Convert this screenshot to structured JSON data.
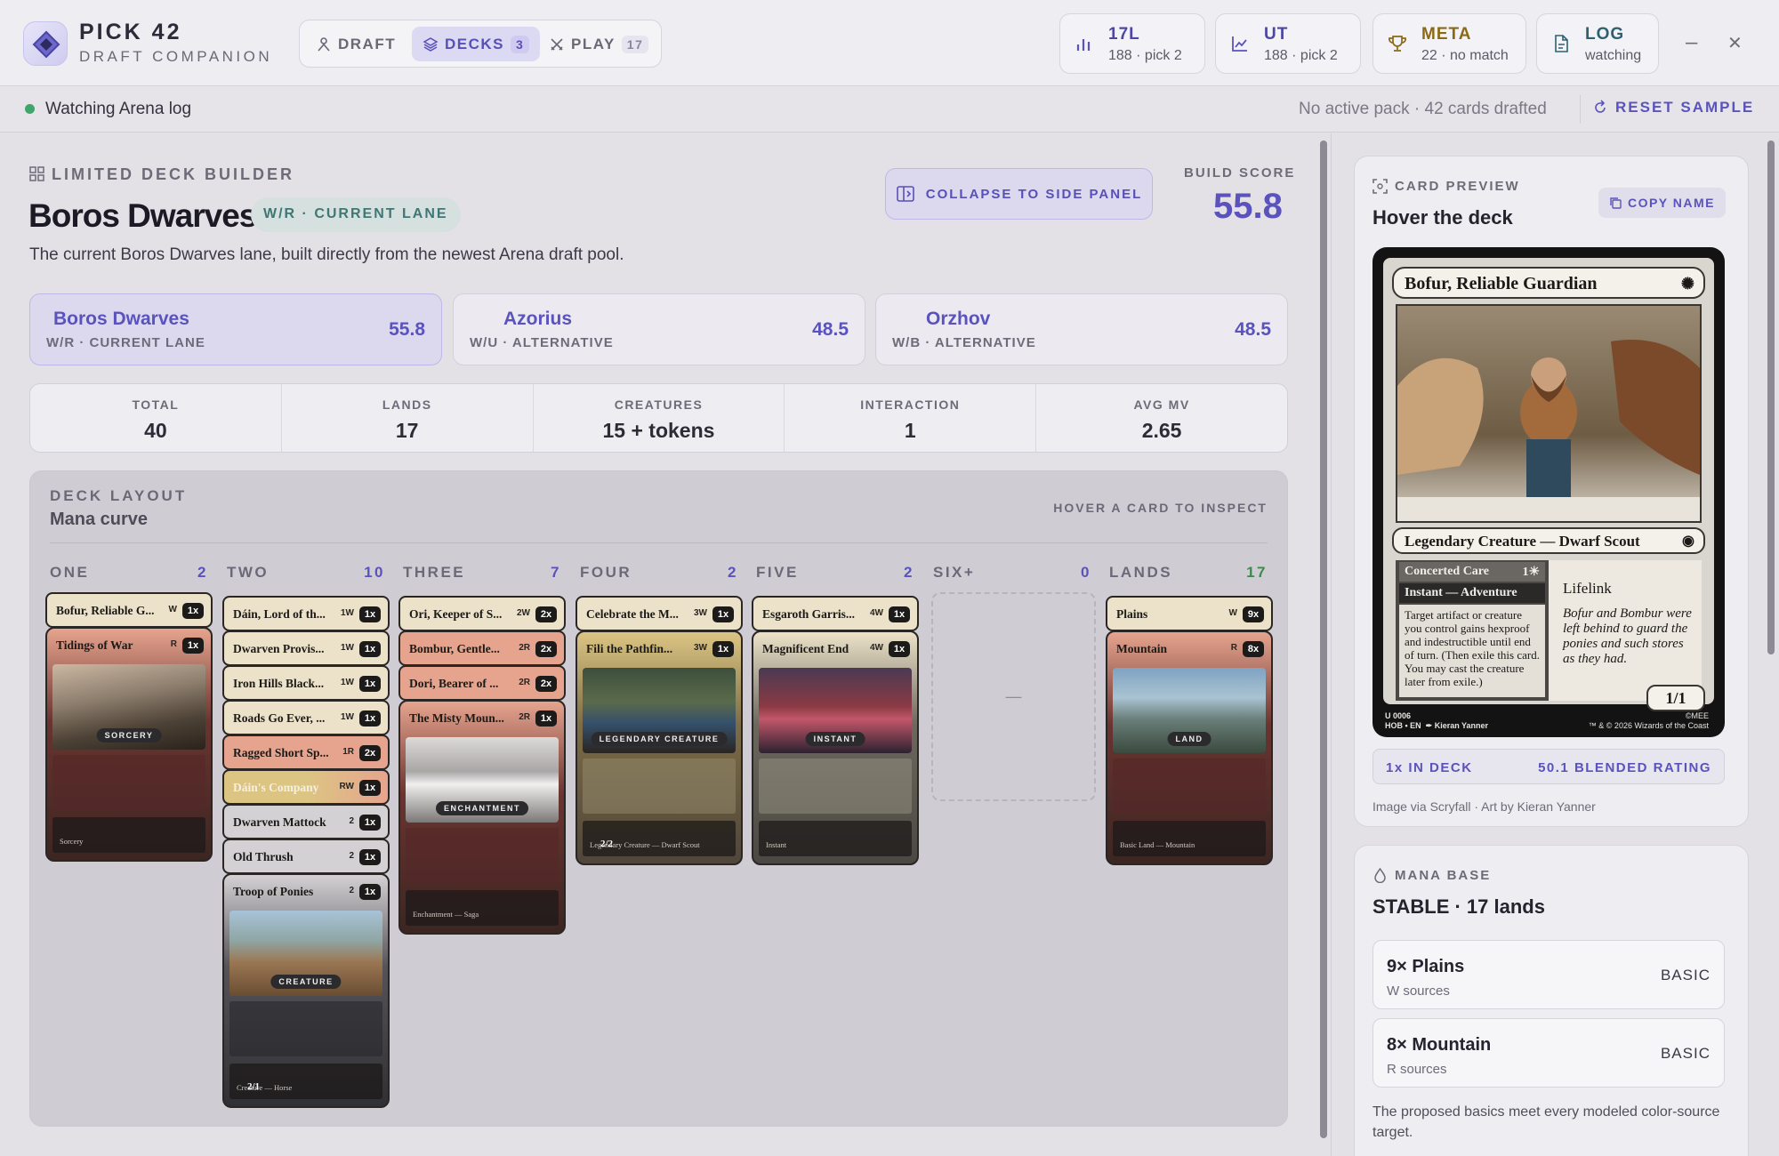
{
  "app": {
    "name": "PICK 42",
    "subtitle": "DRAFT COMPANION"
  },
  "nav": [
    {
      "label": "DRAFT",
      "count": ""
    },
    {
      "label": "DECKS",
      "count": "3"
    },
    {
      "label": "PLAY",
      "count": "17"
    }
  ],
  "top_stats": [
    {
      "title": "17L",
      "sub": "188 · pick 2"
    },
    {
      "title": "UT",
      "sub": "188 · pick 2"
    },
    {
      "title": "META",
      "sub": "22 · no match"
    },
    {
      "title": "LOG",
      "sub": "watching"
    }
  ],
  "window": {
    "minimize": "–",
    "close": "✕"
  },
  "status": {
    "text": "Watching Arena log",
    "right": "No active pack · 42 cards drafted",
    "reset": "RESET SAMPLE"
  },
  "builder": {
    "section": "LIMITED DECK BUILDER",
    "title": "Boros Dwarves",
    "lane_pill": "W/R · CURRENT LANE",
    "description": "The current Boros Dwarves lane, built directly from the newest Arena draft pool.",
    "collapse": "COLLAPSE TO SIDE PANEL",
    "build_label": "BUILD SCORE",
    "build_score": "55.8"
  },
  "lanes": [
    {
      "name": "Boros Dwarves",
      "type": "W/R · CURRENT LANE",
      "score": "55.8"
    },
    {
      "name": "Azorius",
      "type": "W/U · ALTERNATIVE",
      "score": "48.5"
    },
    {
      "name": "Orzhov",
      "type": "W/B · ALTERNATIVE",
      "score": "48.5"
    }
  ],
  "stats": [
    {
      "label": "TOTAL",
      "value": "40"
    },
    {
      "label": "LANDS",
      "value": "17"
    },
    {
      "label": "CREATURES",
      "value": "15 + tokens"
    },
    {
      "label": "INTERACTION",
      "value": "1"
    },
    {
      "label": "AVG MV",
      "value": "2.65"
    }
  ],
  "layout": {
    "label": "DECK LAYOUT",
    "title": "Mana curve",
    "hint": "HOVER A CARD TO INSPECT",
    "empty_marker": "—",
    "columns": [
      {
        "name": "ONE",
        "count": "2"
      },
      {
        "name": "TWO",
        "count": "10"
      },
      {
        "name": "THREE",
        "count": "7"
      },
      {
        "name": "FOUR",
        "count": "2"
      },
      {
        "name": "FIVE",
        "count": "2"
      },
      {
        "name": "SIX+",
        "count": "0"
      },
      {
        "name": "LANDS",
        "count": "17"
      }
    ]
  },
  "cards": {
    "one": [
      {
        "name": "Bofur, Reliable G...",
        "cost": "W",
        "qty": "1x"
      },
      {
        "name": "Tidings of War",
        "cost": "R",
        "qty": "1x",
        "type": "SORCERY",
        "bottom": "Sorcery",
        "pt": ""
      }
    ],
    "two": [
      {
        "name": "Dáin, Lord of th...",
        "cost": "1W",
        "qty": "1x"
      },
      {
        "name": "Dwarven Provis...",
        "cost": "1W",
        "qty": "1x"
      },
      {
        "name": "Iron Hills Black...",
        "cost": "1W",
        "qty": "1x"
      },
      {
        "name": "Roads Go Ever, ...",
        "cost": "1W",
        "qty": "1x"
      },
      {
        "name": "Ragged Short Sp...",
        "cost": "1R",
        "qty": "2x"
      },
      {
        "name": "Dáin's Company",
        "cost": "RW",
        "qty": "1x"
      },
      {
        "name": "Dwarven Mattock",
        "cost": "2",
        "qty": "1x"
      },
      {
        "name": "Old Thrush",
        "cost": "2",
        "qty": "1x"
      },
      {
        "name": "Troop of Ponies",
        "cost": "2",
        "qty": "1x",
        "type": "CREATURE",
        "bottom": "Creature — Horse",
        "pt": "2/1"
      }
    ],
    "three": [
      {
        "name": "Ori, Keeper of S...",
        "cost": "2W",
        "qty": "2x"
      },
      {
        "name": "Bombur, Gentle...",
        "cost": "2R",
        "qty": "2x"
      },
      {
        "name": "Dori, Bearer of ...",
        "cost": "2R",
        "qty": "2x"
      },
      {
        "name": "The Misty Moun...",
        "cost": "2R",
        "qty": "1x",
        "type": "ENCHANTMENT",
        "bottom": "Enchantment — Saga",
        "pt": ""
      }
    ],
    "four": [
      {
        "name": "Celebrate the M...",
        "cost": "3W",
        "qty": "1x"
      },
      {
        "name": "Fili the Pathfin...",
        "cost": "3W",
        "qty": "1x",
        "type": "LEGENDARY CREATURE",
        "bottom": "Legendary Creature — Dwarf Scout",
        "pt": "2/2"
      }
    ],
    "five": [
      {
        "name": "Esgaroth Garris...",
        "cost": "4W",
        "qty": "1x"
      },
      {
        "name": "Magnificent End",
        "cost": "4W",
        "qty": "1x",
        "type": "INSTANT",
        "bottom": "Instant",
        "pt": ""
      }
    ],
    "lands": [
      {
        "name": "Plains",
        "cost": "W",
        "qty": "9x"
      },
      {
        "name": "Mountain",
        "cost": "R",
        "qty": "8x",
        "type": "LAND",
        "bottom": "Basic Land — Mountain",
        "pt": ""
      }
    ]
  },
  "preview": {
    "label": "CARD PREVIEW",
    "title": "Hover the deck",
    "copy": "COPY NAME",
    "card_name": "Bofur, Reliable Guardian",
    "type_line": "Legendary Creature — Dwarf Scout",
    "adventure_name": "Concerted Care",
    "adventure_cost": "1☀",
    "adventure_type": "Instant — Adventure",
    "adventure_text": "Target artifact or creature you control gains hexproof and indestructible until end of turn. (Then exile this card. You may cast the creature later from exile.)",
    "keyword": "Lifelink",
    "flavor": "Bofur and Bombur were left behind to guard the ponies and such stores as they had.",
    "pt": "1/1",
    "footer_left": "U 0006\nHOB • EN  ✒ Kieran Yanner",
    "footer_right": "©MEE\n™ & © 2026 Wizards of the Coast",
    "in_deck": "1x IN DECK",
    "rating": "50.1 BLENDED RATING",
    "credit": "Image via Scryfall · Art by Kieran Yanner"
  },
  "mana_base": {
    "label": "MANA BASE",
    "title": "STABLE · 17 lands",
    "rows": [
      {
        "name": "9× Plains",
        "sub": "W sources",
        "kind": "BASIC"
      },
      {
        "name": "8× Mountain",
        "sub": "R sources",
        "kind": "BASIC"
      }
    ],
    "note": "The proposed basics meet every modeled color-source target."
  },
  "colors": {
    "accent": "#5a53bd",
    "lane_teal": "#3f7774",
    "lands_green": "#3d8a4a",
    "status_green": "#3fa56b"
  }
}
